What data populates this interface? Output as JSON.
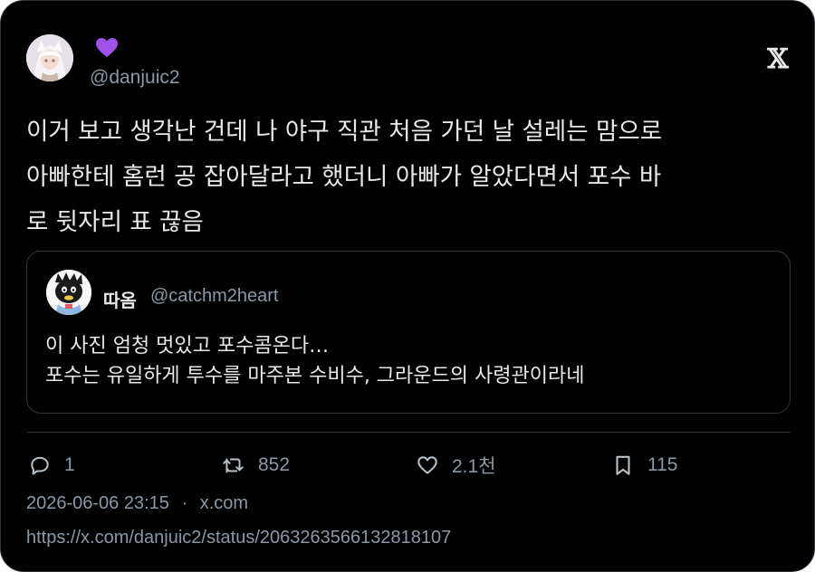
{
  "author": {
    "emoji_icon": "purple-heart-icon",
    "handle": "@danjuic2"
  },
  "tweet": {
    "text": "이거 보고 생각난 건데 나 야구 직관 처음 가던 날 설레는 맘으로\n아빠한테 홈런 공 잡아달라고 했더니 아빠가 알았다면서 포수 바\n로 뒷자리 표 끊음"
  },
  "quoted": {
    "name": "따옴",
    "handle": "@catchm2heart",
    "text": "이 사진 엄청 멋있고 포수콤온다…\n포수는 유일하게 투수를 마주본 수비수, 그라운드의 사령관이라네"
  },
  "actions": {
    "reply_count": "1",
    "retweet_count": "852",
    "like_count": "2.1천",
    "bookmark_count": "115"
  },
  "meta": {
    "timestamp": "2026-06-06 23:15",
    "separator": "·",
    "source": "x.com",
    "url": "https://x.com/danjuic2/status/2063263566132818107"
  },
  "colors": {
    "background": "#000000",
    "text": "#e7e9ea",
    "muted": "#8b98a5",
    "border": "#2f3336",
    "heart_emoji": "#a051e8"
  }
}
